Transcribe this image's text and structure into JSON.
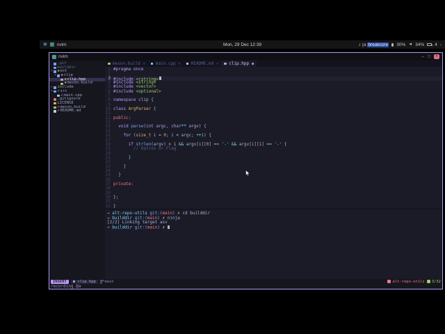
{
  "colors": {
    "accent": "#bb9af7",
    "window_border": "#ab9df2",
    "editor_bg": "#1a1b26",
    "panel_bg": "#151517",
    "mode_chip": "#bb9af7",
    "project_badge": "#f7768e",
    "position_badge": "#9ece6a"
  },
  "panel": {
    "workspace_icon": "✻",
    "app_title": "nvim",
    "clock": "Mon, 29 Dec 12:39",
    "media_prefix": "♪ (a ",
    "media_highlight": "breakcore",
    "mic_level": "30%",
    "volume_level": "34%",
    "battery_level": "4",
    "chevron": "›"
  },
  "window": {
    "title": "nvim",
    "minimize": "–",
    "maximize": "□",
    "close": "×"
  },
  "bufferline": {
    "tabs": [
      {
        "label": "meson.build",
        "icon": "meson",
        "right": "×",
        "active": false
      },
      {
        "label": "main.cpp",
        "icon": "cpp",
        "right": "×",
        "active": false
      },
      {
        "label": "README.md",
        "icon": "md",
        "right": "×",
        "active": false
      },
      {
        "label": "clip.hpp",
        "icon": "hpp",
        "right": "●",
        "active": true
      }
    ]
  },
  "filetree": {
    "items": [
      {
        "ind": 0,
        "arrow": "",
        "icon": "folder",
        "git": "",
        "name": ".git",
        "dim": true,
        "selected": false
      },
      {
        "ind": 0,
        "arrow": "",
        "icon": "folder",
        "git": "",
        "name": "builddir",
        "dim": true,
        "selected": false
      },
      {
        "ind": 0,
        "arrow": "▾",
        "icon": "folder",
        "git": "✱",
        "name": "ext",
        "dim": false,
        "selected": false
      },
      {
        "ind": 1,
        "arrow": "▾",
        "icon": "folder",
        "git": "✱",
        "name": "clip",
        "dim": false,
        "selected": false
      },
      {
        "ind": 2,
        "arrow": "",
        "icon": "hpp",
        "git": "✱",
        "name": "clip.hpp",
        "dim": false,
        "selected": true
      },
      {
        "ind": 2,
        "arrow": "",
        "icon": "meson",
        "git": "✱",
        "name": "meson.build",
        "dim": false,
        "selected": false
      },
      {
        "ind": 0,
        "arrow": "▸",
        "icon": "folder",
        "git": "",
        "name": "include",
        "dim": false,
        "selected": false
      },
      {
        "ind": 0,
        "arrow": "▾",
        "icon": "folder",
        "git": "✗",
        "name": "src",
        "dim": false,
        "selected": false
      },
      {
        "ind": 1,
        "arrow": "",
        "icon": "cpp",
        "git": "✗",
        "name": "main.cpp",
        "dim": false,
        "selected": false
      },
      {
        "ind": 0,
        "arrow": "",
        "icon": "gear",
        "git": "",
        "name": ".gitignore",
        "dim": false,
        "selected": false
      },
      {
        "ind": 0,
        "arrow": "",
        "icon": "file",
        "git": "",
        "name": "LICENSE",
        "dim": false,
        "selected": false
      },
      {
        "ind": 0,
        "arrow": "",
        "icon": "meson",
        "git": "✗",
        "name": "meson.build",
        "dim": false,
        "selected": false
      },
      {
        "ind": 0,
        "arrow": "",
        "icon": "md",
        "git": "✗",
        "name": "README.md",
        "dim": false,
        "selected": false
      }
    ]
  },
  "editor": {
    "lines": [
      {
        "n": 1,
        "s": [
          [
            "#pragma once",
            "pp"
          ]
        ]
      },
      {
        "n": 2,
        "s": []
      },
      {
        "n": 3,
        "cur": true,
        "s": [
          [
            "#include ",
            "pp"
          ],
          [
            "<cstring>",
            "str"
          ]
        ]
      },
      {
        "n": 4,
        "s": [
          [
            "#include ",
            "pp"
          ],
          [
            "<string>",
            "str"
          ]
        ]
      },
      {
        "n": 5,
        "s": [
          [
            "#include ",
            "pp"
          ],
          [
            "<vector>",
            "str"
          ]
        ]
      },
      {
        "n": 6,
        "s": [
          [
            "#include ",
            "pp"
          ],
          [
            "<optional>",
            "str"
          ]
        ]
      },
      {
        "n": 7,
        "s": []
      },
      {
        "n": 8,
        "s": [
          [
            "namespace",
            "kw"
          ],
          [
            " clip {",
            "fg"
          ]
        ]
      },
      {
        "n": 9,
        "s": []
      },
      {
        "n": 10,
        "s": [
          [
            "class",
            "kw"
          ],
          [
            " ",
            "fg"
          ],
          [
            "ArgParser",
            "ty"
          ],
          [
            " {",
            "fg"
          ]
        ]
      },
      {
        "n": 11,
        "s": []
      },
      {
        "n": 12,
        "s": [
          [
            "public",
            "acc"
          ],
          [
            ":",
            "fg"
          ]
        ]
      },
      {
        "n": 13,
        "s": []
      },
      {
        "n": 14,
        "s": [
          [
            "  ",
            "fg"
          ],
          [
            "void",
            "kw"
          ],
          [
            " ",
            "fg"
          ],
          [
            "parse",
            "fn"
          ],
          [
            "(",
            "fg"
          ],
          [
            "int",
            "kw"
          ],
          [
            " argc, ",
            "fg"
          ],
          [
            "char",
            "kw"
          ],
          [
            "**",
            "op"
          ],
          [
            " argv) {",
            "fg"
          ]
        ]
      },
      {
        "n": 15,
        "s": []
      },
      {
        "n": 16,
        "s": [
          [
            "    ",
            "fg"
          ],
          [
            "for",
            "kw"
          ],
          [
            " (",
            "fg"
          ],
          [
            "size_t",
            "ty"
          ],
          [
            " i ",
            "fg"
          ],
          [
            "=",
            "op"
          ],
          [
            " ",
            "fg"
          ],
          [
            "0",
            "num"
          ],
          [
            "; i ",
            "fg"
          ],
          [
            "<",
            "op"
          ],
          [
            " argc; ",
            "fg"
          ],
          [
            "++",
            "op"
          ],
          [
            "i) {",
            "fg"
          ]
        ]
      },
      {
        "n": 17,
        "s": []
      },
      {
        "n": 18,
        "s": [
          [
            "      ",
            "fg"
          ],
          [
            "if",
            "kw"
          ],
          [
            " ",
            "fg"
          ],
          [
            "strlen",
            "fn"
          ],
          [
            "(argv) ",
            "fg"
          ],
          [
            ">",
            "op"
          ],
          [
            " ",
            "fg"
          ],
          [
            "1",
            "num"
          ],
          [
            " ",
            "fg"
          ],
          [
            "&&",
            "op"
          ],
          [
            " argv[i][",
            "fg"
          ],
          [
            "0",
            "num"
          ],
          [
            "] ",
            "fg"
          ],
          [
            "==",
            "op"
          ],
          [
            " ",
            "fg"
          ],
          [
            "'-'",
            "str"
          ],
          [
            " ",
            "fg"
          ],
          [
            "&&",
            "op"
          ],
          [
            " argv[i][",
            "fg"
          ],
          [
            "1",
            "num"
          ],
          [
            "] ",
            "fg"
          ],
          [
            "==",
            "op"
          ],
          [
            " ",
            "fg"
          ],
          [
            "'-'",
            "str"
          ],
          [
            " {",
            "fg"
          ]
        ]
      },
      {
        "n": 19,
        "s": [
          [
            "        ",
            "fg"
          ],
          [
            "// Option or Flag",
            "cmt"
          ]
        ]
      },
      {
        "n": 20,
        "s": []
      },
      {
        "n": 21,
        "s": [
          [
            "      }",
            "fg"
          ]
        ]
      },
      {
        "n": 22,
        "s": []
      },
      {
        "n": 23,
        "s": [
          [
            "    }",
            "fg"
          ]
        ]
      },
      {
        "n": 24,
        "s": []
      },
      {
        "n": 25,
        "s": [
          [
            "  }",
            "fg"
          ]
        ]
      },
      {
        "n": 26,
        "s": []
      },
      {
        "n": 27,
        "s": [
          [
            "private",
            "acc"
          ],
          [
            ":",
            "fg"
          ]
        ]
      },
      {
        "n": 28,
        "s": []
      },
      {
        "n": 29,
        "s": []
      },
      {
        "n": 30,
        "s": [
          [
            "};",
            "fg"
          ]
        ]
      },
      {
        "n": 31,
        "s": []
      },
      {
        "n": 32,
        "s": [
          [
            "}",
            "fg"
          ]
        ]
      }
    ]
  },
  "terminal": {
    "lines": [
      {
        "cursor": false,
        "s": [
          [
            "→ ",
            "g"
          ],
          [
            "alt-repo-utils ",
            "c"
          ],
          [
            "git:(",
            "b"
          ],
          [
            "main",
            "r"
          ],
          [
            ") ",
            "b"
          ],
          [
            "✗ ",
            "y"
          ],
          [
            "cd builddir",
            "f"
          ]
        ]
      },
      {
        "cursor": false,
        "s": [
          [
            "→ ",
            "g"
          ],
          [
            "builddir ",
            "c"
          ],
          [
            "git:(",
            "b"
          ],
          [
            "main",
            "r"
          ],
          [
            ") ",
            "b"
          ],
          [
            "✗ ",
            "y"
          ],
          [
            "ninja",
            "f"
          ]
        ]
      },
      {
        "cursor": false,
        "s": [
          [
            "[2/2] Linking target asv",
            "f"
          ]
        ]
      },
      {
        "cursor": true,
        "s": [
          [
            "→ ",
            "g"
          ],
          [
            "builddir ",
            "c"
          ],
          [
            "git:(",
            "b"
          ],
          [
            "main",
            "r"
          ],
          [
            ") ",
            "b"
          ],
          [
            "✗ ",
            "y"
          ]
        ]
      }
    ]
  },
  "statusline": {
    "mode": "INSERT",
    "file": "clip.hpp",
    "branch": "main",
    "project": "alt-repo-utils",
    "position": "3/32"
  },
  "cmdline": "recording @a"
}
